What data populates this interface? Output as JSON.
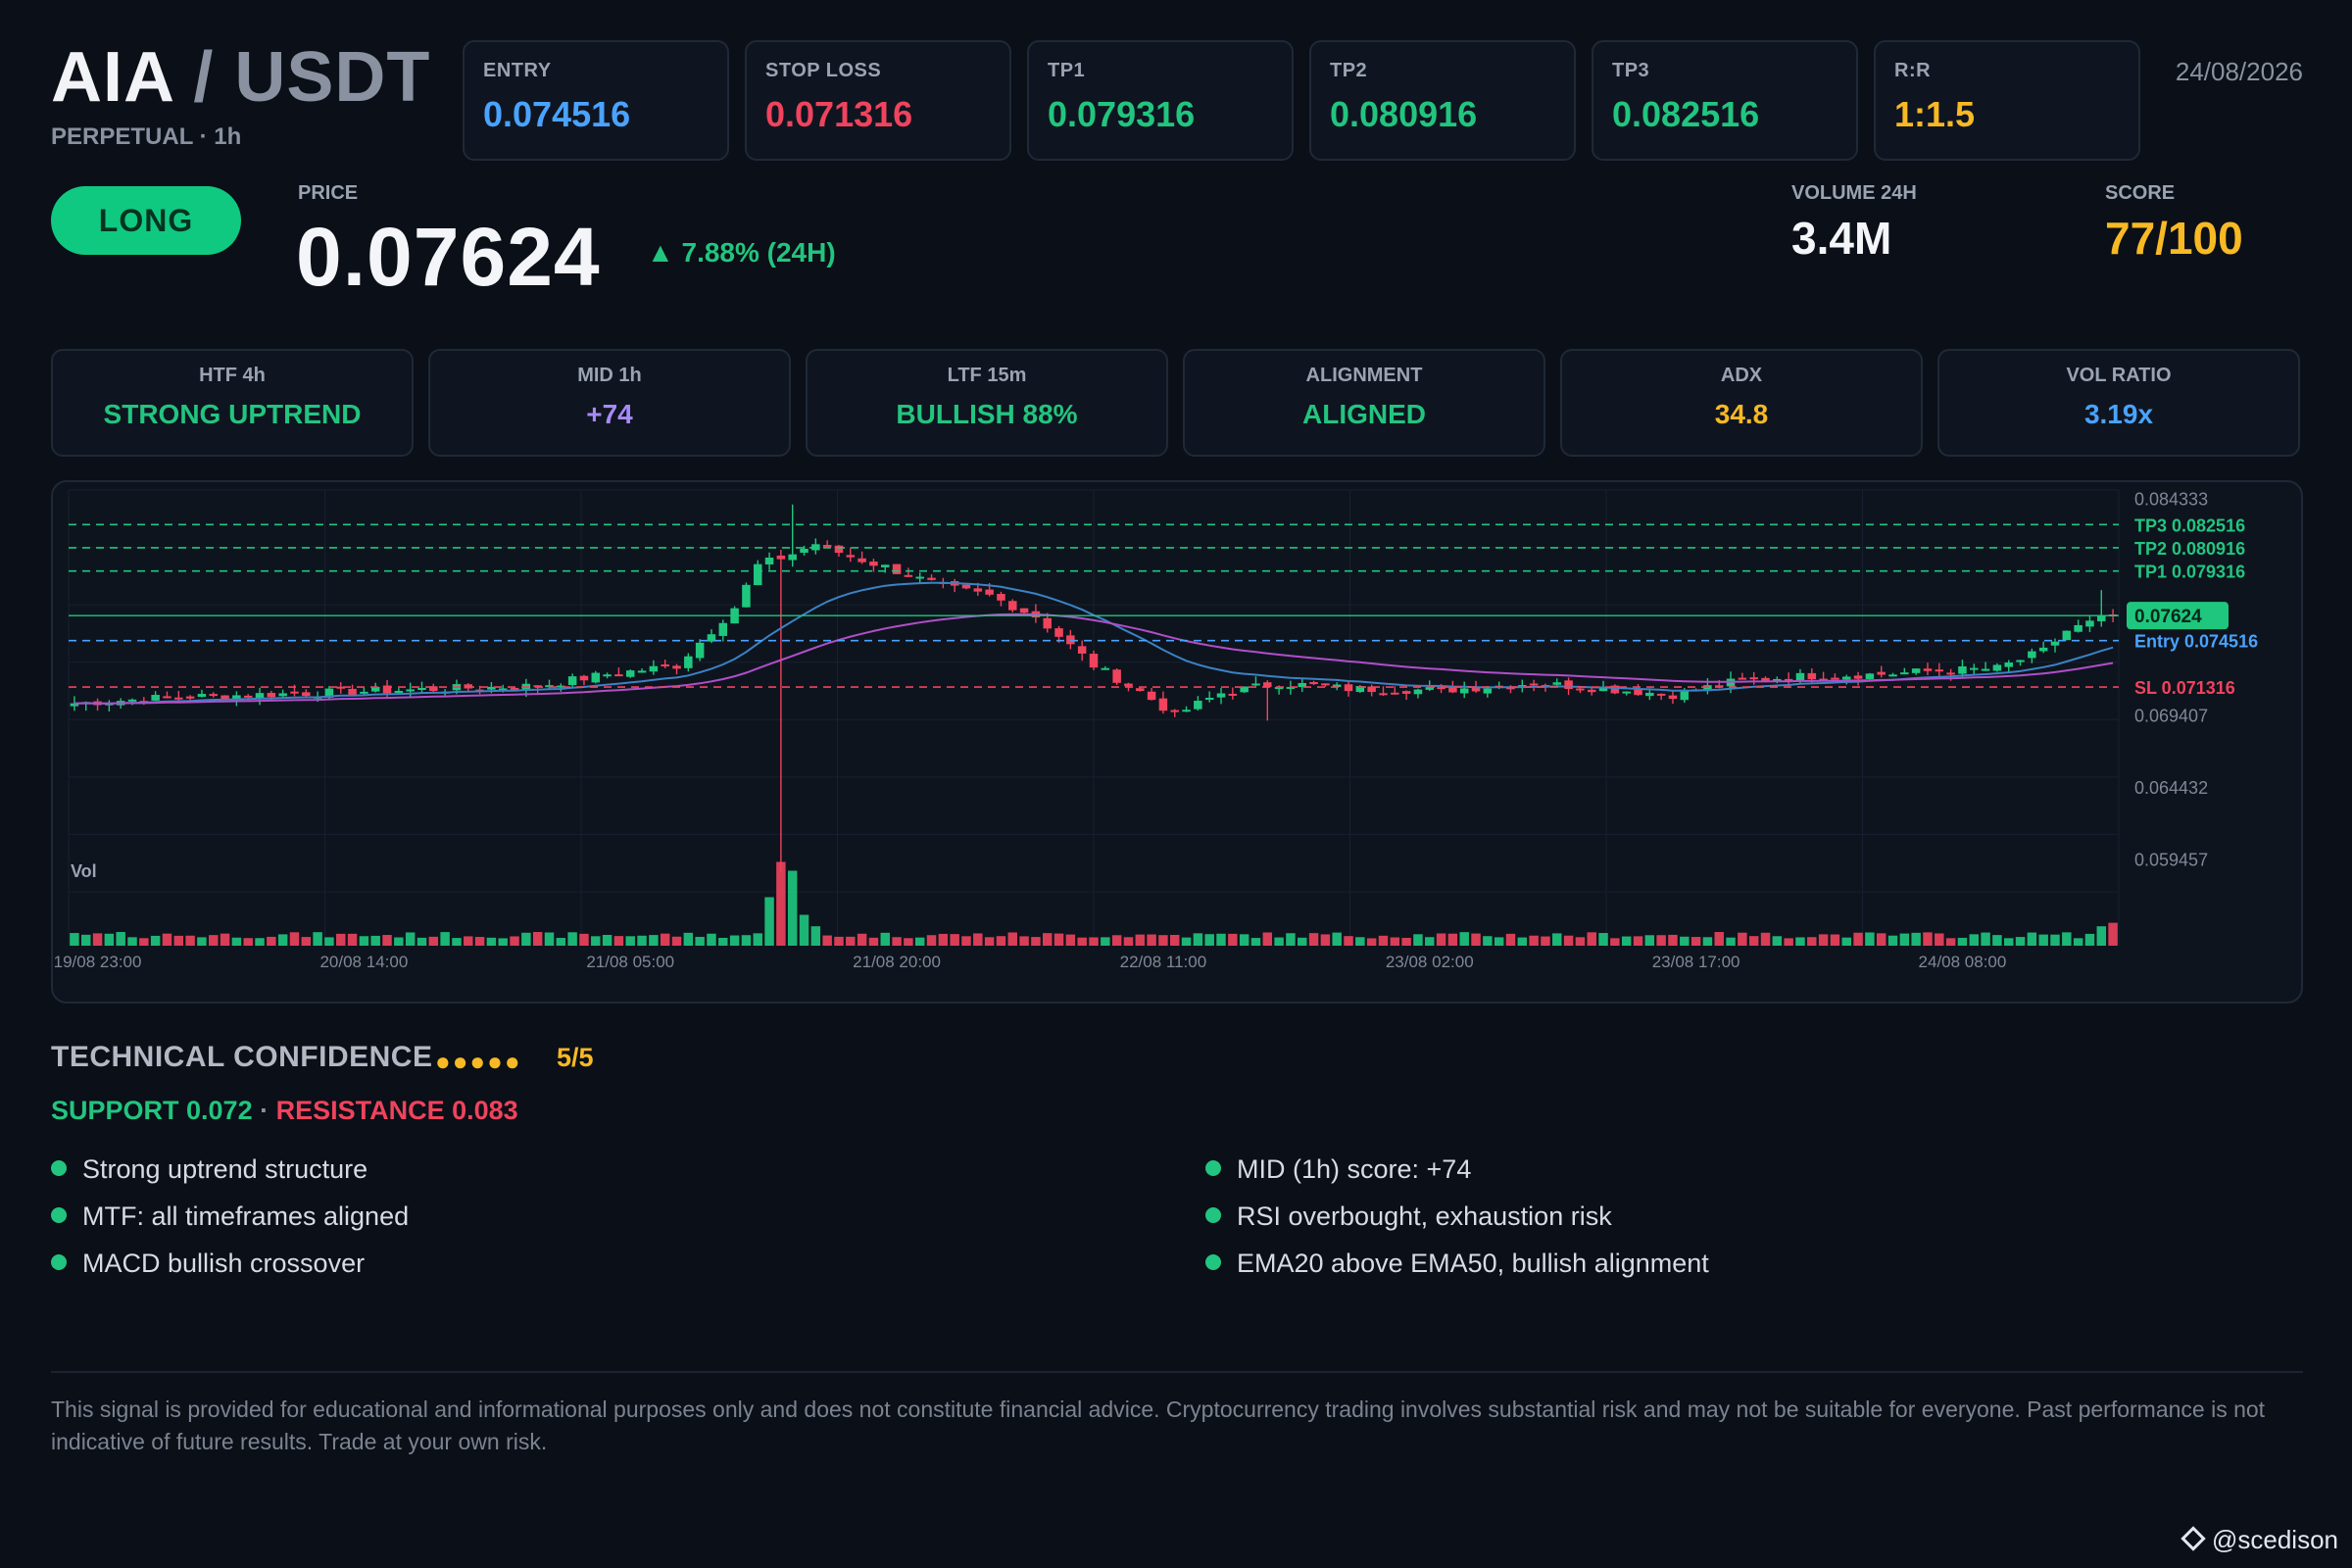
{
  "header": {
    "base": "AIA",
    "separator": " / ",
    "quote": "USDT",
    "subtitle": "PERPETUAL · 1h",
    "date": "24/08/2026"
  },
  "stats": [
    {
      "label": "ENTRY",
      "value": "0.074516",
      "color": "#4aa3ff"
    },
    {
      "label": "STOP LOSS",
      "value": "0.071316",
      "color": "#f0435d"
    },
    {
      "label": "TP1",
      "value": "0.079316",
      "color": "#22c57f"
    },
    {
      "label": "TP2",
      "value": "0.080916",
      "color": "#22c57f"
    },
    {
      "label": "TP3",
      "value": "0.082516",
      "color": "#22c57f"
    },
    {
      "label": "R:R",
      "value": "1:1.5",
      "color": "#f7b924"
    }
  ],
  "signal": {
    "direction": "LONG",
    "price_label": "PRICE",
    "price": "0.07624",
    "change": "▲ 7.88% (24H)",
    "volume_label": "VOLUME 24H",
    "volume": "3.4M",
    "score_label": "SCORE",
    "score": "77/100"
  },
  "timeframes": [
    {
      "label": "HTF 4h",
      "value": "STRONG UPTREND",
      "color": "#22c57f"
    },
    {
      "label": "MID 1h",
      "value": "+74",
      "color": "#a78bfa"
    },
    {
      "label": "LTF 15m",
      "value": "BULLISH 88%",
      "color": "#22c57f"
    },
    {
      "label": "ALIGNMENT",
      "value": "ALIGNED",
      "color": "#22c57f"
    },
    {
      "label": "ADX",
      "value": "34.8",
      "color": "#f7b924"
    },
    {
      "label": "VOL RATIO",
      "value": "3.19x",
      "color": "#4aa3ff"
    }
  ],
  "chart_data": {
    "type": "candlestick",
    "interval": "1h",
    "y_ticks": [
      "0.084333",
      "0.069407",
      "0.064432",
      "0.059457"
    ],
    "ylim": [
      0.0572,
      0.0849
    ],
    "x_ticks": [
      "19/08 23:00",
      "20/08 14:00",
      "21/08 05:00",
      "21/08 20:00",
      "22/08 11:00",
      "23/08 02:00",
      "23/08 17:00",
      "24/08 08:00"
    ],
    "levels": [
      {
        "name": "TP3",
        "value": 0.082516,
        "label": "TP3 0.082516",
        "color": "#22c57f"
      },
      {
        "name": "TP2",
        "value": 0.080916,
        "label": "TP2 0.080916",
        "color": "#22c57f"
      },
      {
        "name": "TP1",
        "value": 0.079316,
        "label": "TP1 0.079316",
        "color": "#22c57f"
      },
      {
        "name": "Entry",
        "value": 0.074516,
        "label": "Entry 0.074516",
        "color": "#4aa3ff"
      },
      {
        "name": "SL",
        "value": 0.071316,
        "label": "SL 0.071316",
        "color": "#f0435d"
      }
    ],
    "current_price": {
      "value": 0.07624,
      "label": "0.07624"
    },
    "volume_label": "Vol",
    "colors": {
      "up": "#1fc77e",
      "down": "#f0435d",
      "ema_fast": "#3b82c4",
      "ema_slow": "#b04fc8",
      "grid": "#172030"
    },
    "close_anchors": [
      [
        0,
        0.0702
      ],
      [
        8,
        0.0706
      ],
      [
        16,
        0.0708
      ],
      [
        24,
        0.071
      ],
      [
        32,
        0.0712
      ],
      [
        40,
        0.0714
      ],
      [
        46,
        0.0722
      ],
      [
        52,
        0.0728
      ],
      [
        57,
        0.0768
      ],
      [
        59,
        0.0797
      ],
      [
        62,
        0.0805
      ],
      [
        64,
        0.0812
      ],
      [
        67,
        0.0803
      ],
      [
        70,
        0.0796
      ],
      [
        75,
        0.0782
      ],
      [
        79,
        0.0776
      ],
      [
        83,
        0.0762
      ],
      [
        88,
        0.0728
      ],
      [
        92,
        0.071
      ],
      [
        95,
        0.0694
      ],
      [
        99,
        0.0709
      ],
      [
        104,
        0.0716
      ],
      [
        110,
        0.0712
      ],
      [
        118,
        0.0711
      ],
      [
        126,
        0.0716
      ],
      [
        132,
        0.0712
      ],
      [
        138,
        0.0708
      ],
      [
        144,
        0.0718
      ],
      [
        150,
        0.0721
      ],
      [
        156,
        0.0722
      ],
      [
        160,
        0.0724
      ],
      [
        166,
        0.0726
      ],
      [
        170,
        0.0738
      ],
      [
        172,
        0.0752
      ],
      [
        176,
        0.07624
      ]
    ],
    "candle_count": 177,
    "volume_profile": {
      "base": 0.12,
      "spikes": [
        [
          60,
          0.55
        ],
        [
          61,
          0.95
        ],
        [
          62,
          0.85
        ],
        [
          63,
          0.35
        ],
        [
          64,
          0.22
        ],
        [
          175,
          0.22
        ],
        [
          176,
          0.26
        ]
      ]
    }
  },
  "confidence": {
    "title": "TECHNICAL CONFIDENCE",
    "dots": "●●●●●",
    "score": "5/5",
    "support": "SUPPORT 0.072",
    "separator": " · ",
    "resistance": "RESISTANCE 0.083"
  },
  "reasons": [
    "Strong uptrend structure",
    "MTF: all timeframes aligned",
    "MACD bullish crossover",
    "MID (1h) score: +74",
    "RSI overbought, exhaustion risk",
    "EMA20 above EMA50, bullish alignment"
  ],
  "disclaimer": "This signal is provided for educational and informational purposes only and does not constitute financial advice. Cryptocurrency trading involves substantial risk and may not be suitable for everyone. Past performance is not indicative of future results. Trade at your own risk.",
  "watermark": "@scedison"
}
